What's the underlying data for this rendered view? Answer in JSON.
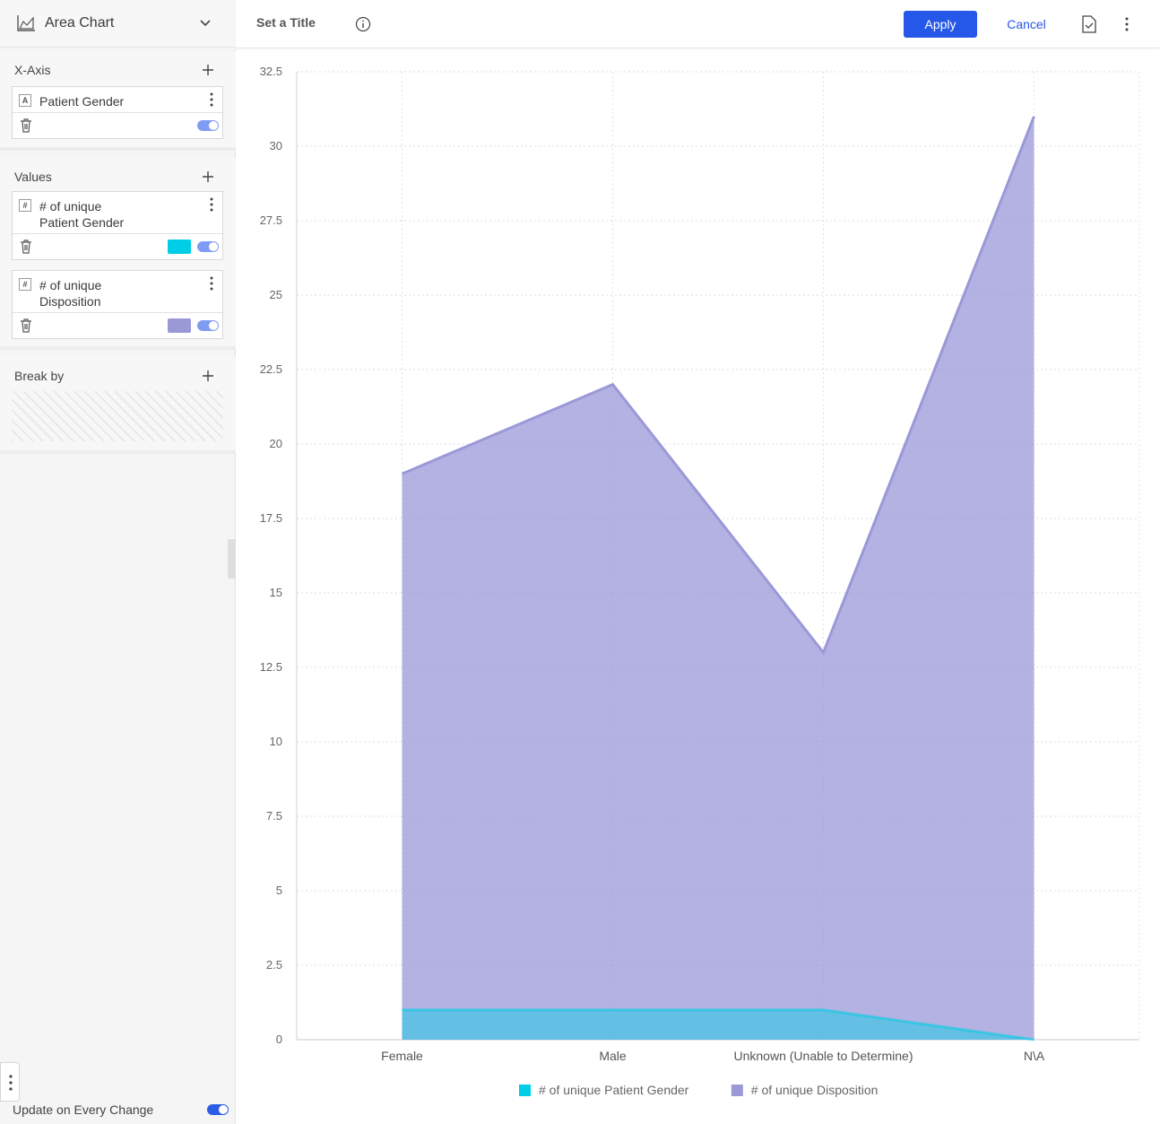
{
  "sidebar": {
    "chart_type": "Area Chart",
    "x_axis": {
      "title": "X-Axis",
      "items": [
        {
          "badge": "A",
          "label": "Patient Gender"
        }
      ]
    },
    "values": {
      "title": "Values",
      "items": [
        {
          "badge": "#",
          "label_line1": "# of unique",
          "label_line2": "Patient Gender",
          "color": "#00cee6"
        },
        {
          "badge": "#",
          "label_line1": "# of unique",
          "label_line2": "Disposition",
          "color": "#9b98d8"
        }
      ]
    },
    "break_by": {
      "title": "Break by"
    },
    "update_label": "Update on Every Change"
  },
  "header": {
    "title": "Set a Title",
    "apply_label": "Apply",
    "cancel_label": "Cancel"
  },
  "chart_data": {
    "type": "area",
    "categories": [
      "Female",
      "Male",
      "Unknown (Unable to Determine)",
      "N\\A"
    ],
    "series": [
      {
        "name": "# of unique Patient Gender",
        "values": [
          1,
          1,
          1,
          0
        ],
        "color": "#00cee6"
      },
      {
        "name": "# of unique Disposition",
        "values": [
          19,
          22,
          13,
          31
        ],
        "color": "#9b98d8"
      }
    ],
    "ylim": [
      0,
      32.5
    ],
    "yticks": [
      "0",
      "2.5",
      "5",
      "7.5",
      "10",
      "12.5",
      "15",
      "17.5",
      "20",
      "22.5",
      "25",
      "27.5",
      "30",
      "32.5"
    ],
    "grid": true,
    "legend_position": "bottom"
  }
}
